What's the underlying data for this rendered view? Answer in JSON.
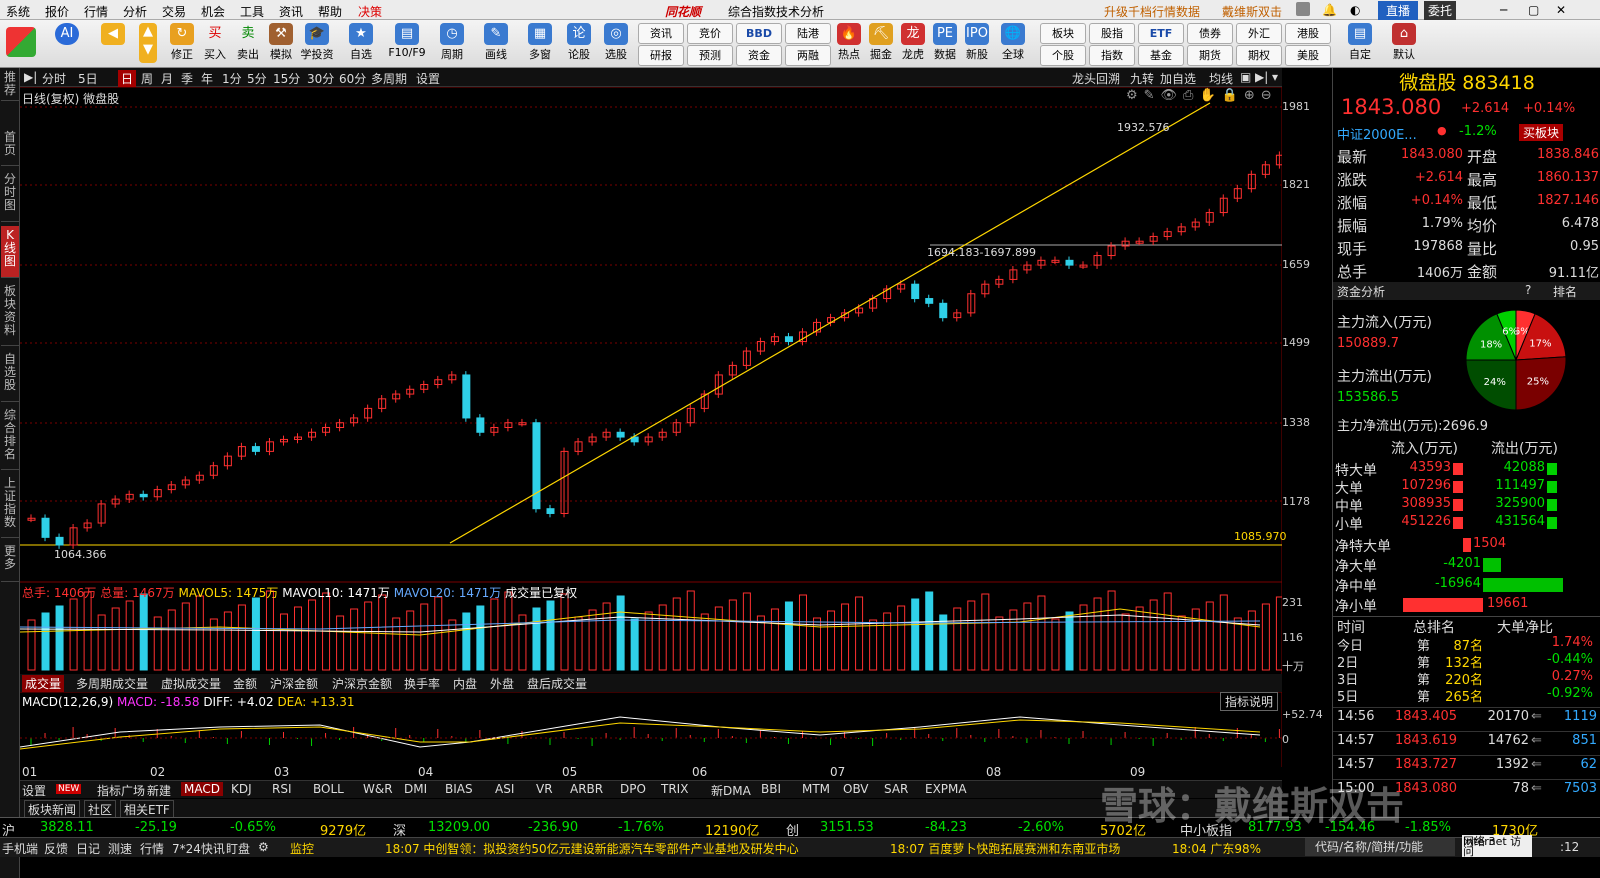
{
  "menu": {
    "items": [
      "系统",
      "报价",
      "行情",
      "分析",
      "交易",
      "机会",
      "工具",
      "资讯",
      "帮助",
      "决策"
    ],
    "brand": "同花顺",
    "center_title": "综合指数技术分析",
    "right1": "升级千档行情数据",
    "right2": "戴维斯双击",
    "zhizhi": "直播",
    "weituo": "委托"
  },
  "toolbar": {
    "main": [
      "修正",
      "买入",
      "卖出",
      "模拟",
      "学投资",
      "自选",
      "F10/F9",
      "周期",
      "画线",
      "多窗",
      "论股",
      "选股"
    ],
    "grid": [
      [
        "资讯",
        "竞价",
        "BBD",
        "陆港"
      ],
      [
        "研报",
        "预测",
        "资金",
        "两融"
      ]
    ],
    "mid": [
      "热点",
      "掘金",
      "龙虎",
      "数据",
      "新股",
      "全球"
    ],
    "grid2": [
      [
        "板块",
        "股指",
        "ETF",
        "债券",
        "外汇",
        "港股"
      ],
      [
        "个股",
        "指数",
        "基金",
        "期货",
        "期权",
        "美股"
      ]
    ],
    "right": [
      "自定",
      "默认"
    ]
  },
  "lefttabs": [
    "推荐",
    "首页",
    "分时图",
    "K线图",
    "板块资料",
    "自选股",
    "综合排名",
    "上证指数",
    "更多"
  ],
  "period": {
    "items": [
      "分时",
      "5日",
      "日",
      "周",
      "月",
      "季",
      "年",
      "1分",
      "5分",
      "15分",
      "30分",
      "60分",
      "多周期",
      "设置"
    ],
    "active": "日",
    "right": [
      "龙头回溯",
      "九转",
      "加自选",
      "均线"
    ]
  },
  "chart_title": "日线(复权) 微盘股",
  "price_axis": [
    "1981",
    "1821",
    "1659",
    "1499",
    "1338",
    "1178"
  ],
  "annotations": {
    "high": "1932.576",
    "gap": "1694.183-1697.899",
    "low": "1064.366",
    "line_val": "1085.970"
  },
  "vol_header": {
    "total": "总手: 1406万",
    "total2": "总量: 1467万",
    "mavol5": "MAVOL5: 1475万",
    "mavol10": "MAVOL10: 1471万",
    "mavol20": "MAVOL20: 1471万",
    "note": "成交量已复权"
  },
  "vol_axis": [
    "231",
    "116",
    "十万"
  ],
  "subtabs": [
    "成交量",
    "多周期成交量",
    "虚拟成交量",
    "金额",
    "沪深金额",
    "沪深京金额",
    "换手率",
    "内盘",
    "外盘",
    "盘后成交量"
  ],
  "macd_header": {
    "name": "MACD(12,26,9)",
    "macd": "MACD: -18.58",
    "diff": "DIFF: +4.02",
    "dea": "DEA: +13.31",
    "help": "指标说明"
  },
  "macd_axis": [
    "+52.74",
    "0"
  ],
  "months": [
    "01",
    "02",
    "03",
    "04",
    "05",
    "06",
    "07",
    "08",
    "09"
  ],
  "indtabs": [
    "设置",
    "NEW",
    "指标广场",
    "新建",
    "MACD",
    "KDJ",
    "RSI",
    "BOLL",
    "W&R",
    "DMI",
    "BIAS",
    "ASI",
    "VR",
    "ARBR",
    "DPO",
    "TRIX",
    "新DMA",
    "BBI",
    "MTM",
    "OBV",
    "SAR",
    "EXPMA"
  ],
  "indtabs2": [
    "板块新闻",
    "社区",
    "相关ETF"
  ],
  "quote": {
    "name": "微盘股",
    "code": "883418",
    "price": "1843.080",
    "chg": "+2.614",
    "pct": "+0.14%",
    "ref": "中证2000E...",
    "ref_pct": "-1.2%",
    "buy_tag": "买板块",
    "rows": [
      [
        "最新",
        "1843.080",
        "开盘",
        "1838.846"
      ],
      [
        "涨跌",
        "+2.614",
        "最高",
        "1860.137"
      ],
      [
        "涨幅",
        "+0.14%",
        "最低",
        "1827.146"
      ],
      [
        "振幅",
        "1.79%",
        "均价",
        "6.478"
      ],
      [
        "现手",
        "197868",
        "量比",
        "0.95"
      ],
      [
        "总手",
        "1406万",
        "金额",
        "91.11亿"
      ]
    ]
  },
  "fund": {
    "title": "资金分析",
    "rank": "排名",
    "in_label": "主力流入(万元)",
    "in_val": "150889.7",
    "out_label": "主力流出(万元)",
    "out_val": "153586.5",
    "net": "主力净流出(万元):2696.9",
    "pie": [
      {
        "label": "6%",
        "color": "#ff3030",
        "value": 6
      },
      {
        "label": "17%",
        "color": "#c81010",
        "value": 17
      },
      {
        "label": "25%",
        "color": "#7a0000",
        "value": 25
      },
      {
        "label": "24%",
        "color": "#004d00",
        "value": 24
      },
      {
        "label": "18%",
        "color": "#009000",
        "value": 18
      },
      {
        "label": "6%",
        "color": "#00d000",
        "value": 6
      }
    ],
    "head": [
      "流入(万元)",
      "流出(万元)"
    ],
    "rows": [
      [
        "特大单",
        "43593",
        "42088"
      ],
      [
        "大单",
        "107296",
        "111497"
      ],
      [
        "中单",
        "308935",
        "325900"
      ],
      [
        "小单",
        "451226",
        "431564"
      ]
    ],
    "net_rows": [
      [
        "净特大单",
        "1504"
      ],
      [
        "净大单",
        "-4201"
      ],
      [
        "净中单",
        "-16964"
      ],
      [
        "净小单",
        "19661"
      ]
    ]
  },
  "rank": {
    "head": [
      "时间",
      "总排名",
      "大单净比"
    ],
    "rows": [
      [
        "今日",
        "第",
        "87名",
        "1.74%"
      ],
      [
        "2日",
        "第",
        "132名",
        "-0.44%"
      ],
      [
        "3日",
        "第",
        "220名",
        "0.27%"
      ],
      [
        "5日",
        "第",
        "265名",
        "-0.92%"
      ]
    ]
  },
  "ticks": [
    [
      "14:56",
      "1843.405",
      "20170",
      "1119"
    ],
    [
      "14:57",
      "1843.619",
      "14762",
      "851"
    ],
    [
      "14:57",
      "1843.727",
      "1392",
      "62"
    ],
    [
      "15:00",
      "1843.080",
      "78",
      "7503"
    ]
  ],
  "status": [
    [
      "沪",
      "3828.11",
      "-25.19",
      "-0.65%",
      "9279亿"
    ],
    [
      "深",
      "13209.00",
      "-236.90",
      "-1.76%",
      "12190亿"
    ],
    [
      "创",
      "3151.53",
      "-84.23",
      "-2.60%",
      "5702亿"
    ],
    [
      "中小板指",
      "8177.93",
      "-154.46",
      "-1.85%",
      "1730亿"
    ]
  ],
  "ticker": {
    "left": [
      "手机端",
      "反馈",
      "日记",
      "测速",
      "行情",
      "7*24快讯",
      "盯盘"
    ],
    "monitor": "监控",
    "news1": "18:07 中创智领：拟投资约50亿元建设新能源汽车零部件产业基地及研发中心",
    "news2": "18:07 百度萝卜快跑拓展赛洲和东南亚市场",
    "news3": "18:04 广东98%",
    "search": "代码/名称/简拼/功能",
    "net": "网络 3",
    "net2": "Internet 访问",
    "time": ":12"
  },
  "watermark": "雪球：戴维斯双击",
  "chart_data": {
    "type": "candlestick",
    "series": [
      {
        "name": "微盘股",
        "values": [
          1120,
          1080,
          1064,
          1100,
          1110,
          1150,
          1160,
          1170,
          1165,
          1180,
          1190,
          1200,
          1210,
          1230,
          1250,
          1270,
          1260,
          1280,
          1285,
          1290,
          1300,
          1310,
          1320,
          1330,
          1350,
          1370,
          1380,
          1390,
          1400,
          1410,
          1420,
          1330,
          1300,
          1310,
          1320,
          1320,
          1140,
          1130,
          1260,
          1280,
          1290,
          1300,
          1290,
          1280,
          1290,
          1300,
          1320,
          1350,
          1380,
          1420,
          1440,
          1470,
          1490,
          1500,
          1490,
          1510,
          1530,
          1540,
          1550,
          1560,
          1580,
          1600,
          1610,
          1580,
          1570,
          1540,
          1550,
          1590,
          1610,
          1620,
          1640,
          1650,
          1660,
          1660,
          1650,
          1650,
          1670,
          1690,
          1700,
          1700,
          1710,
          1720,
          1730,
          1740,
          1760,
          1790,
          1810,
          1840,
          1860,
          1880,
          1900,
          1920,
          1932,
          1860,
          1840,
          1850,
          1880,
          1900,
          1910,
          1920,
          1890,
          1860,
          1850,
          1843
        ]
      }
    ],
    "ylim": [
      1064,
      1981
    ]
  }
}
